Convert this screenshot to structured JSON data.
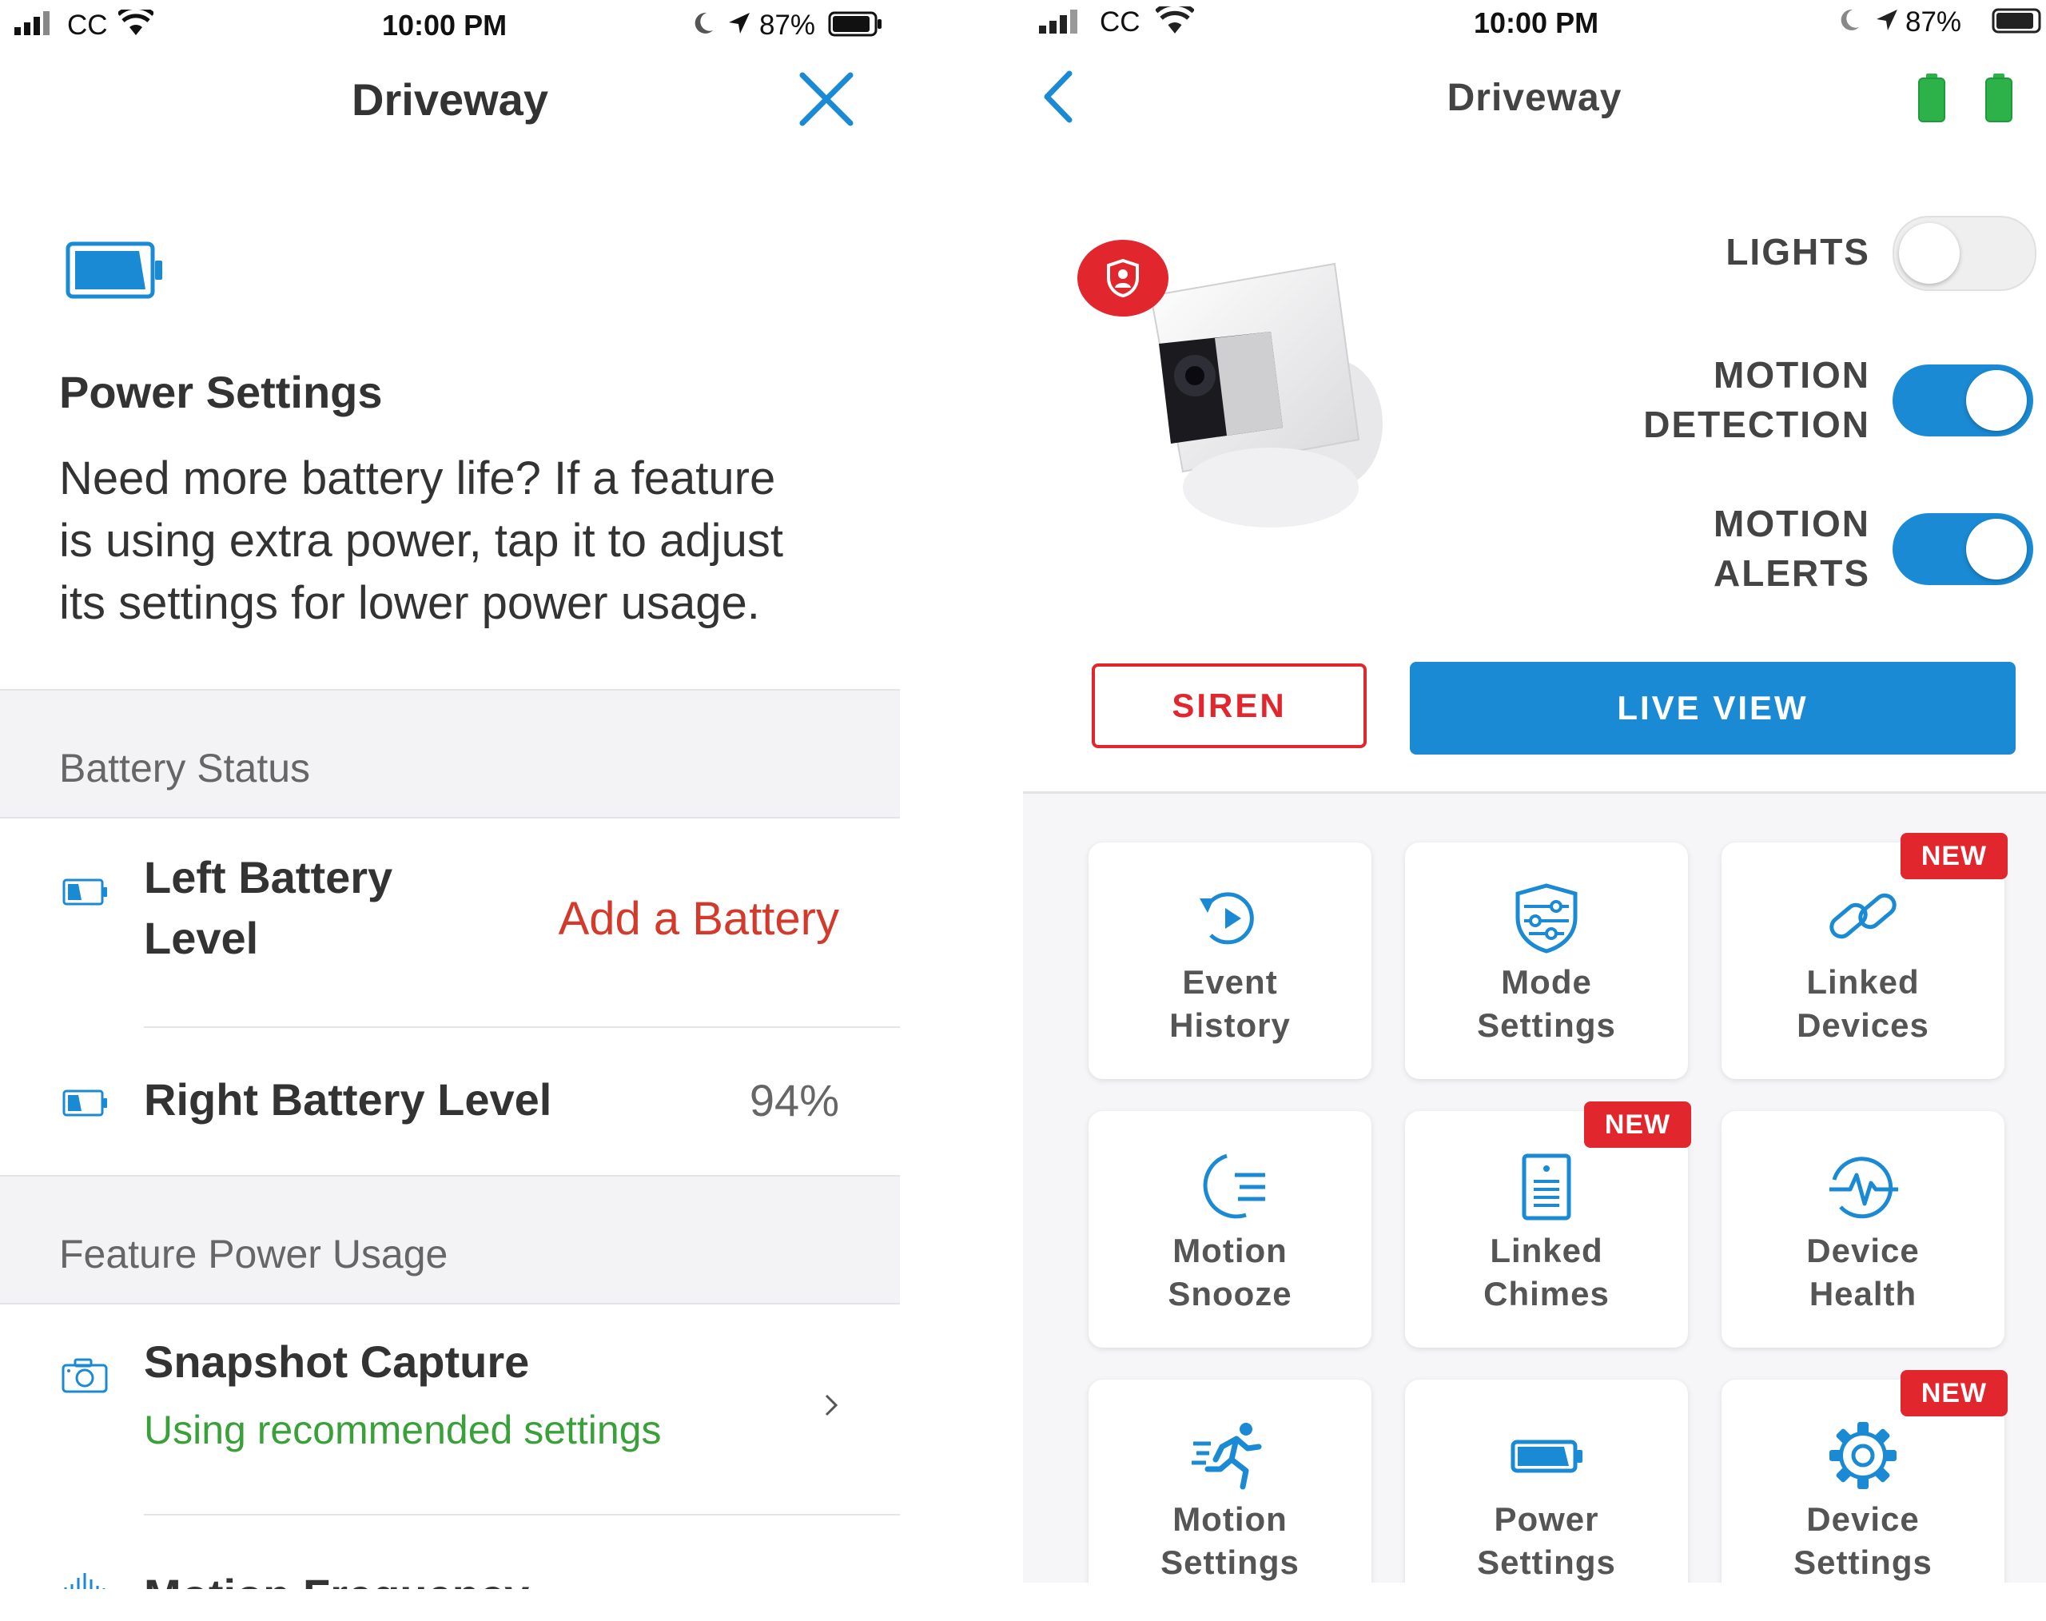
{
  "left": {
    "status_bar": {
      "carrier": "CC",
      "time": "10:00 PM",
      "battery_pct": "87%"
    },
    "nav": {
      "title": "Driveway"
    },
    "intro": {
      "heading": "Power Settings",
      "line1": "Need more battery life? If a feature",
      "line2": "is using extra power, tap it to adjust",
      "line3": "its settings for lower power usage."
    },
    "battery_status": {
      "section_title": "Battery Status",
      "left_line1": "Left Battery",
      "left_line2": "Level",
      "left_action": "Add a Battery",
      "right_label": "Right Battery Level",
      "right_value": "94%"
    },
    "feature_usage": {
      "section_title": "Feature Power Usage",
      "snapshot_title": "Snapshot Capture",
      "snapshot_sub": "Using recommended settings",
      "motion_freq_title": "Motion Frequency"
    }
  },
  "right": {
    "status_bar": {
      "carrier": "CC",
      "time": "10:00 PM",
      "battery_pct": "87%"
    },
    "nav": {
      "title": "Driveway"
    },
    "toggles": {
      "lights": {
        "label": "LIGHTS",
        "on": false
      },
      "motion_detection": {
        "line1": "MOTION",
        "line2": "DETECTION",
        "on": true
      },
      "motion_alerts": {
        "line1": "MOTION",
        "line2": "ALERTS",
        "on": true
      }
    },
    "buttons": {
      "siren": "SIREN",
      "live_view": "LIVE VIEW"
    },
    "colors": {
      "accent": "#1a8ad4",
      "danger": "#e1262d",
      "battery_green": "#2db24a",
      "success": "#3aa13a"
    },
    "tiles": [
      {
        "line1": "Event",
        "line2": "History",
        "icon": "event-history-icon",
        "badge": ""
      },
      {
        "line1": "Mode",
        "line2": "Settings",
        "icon": "mode-settings-icon",
        "badge": ""
      },
      {
        "line1": "Linked",
        "line2": "Devices",
        "icon": "link-icon",
        "badge": "NEW"
      },
      {
        "line1": "Motion",
        "line2": "Snooze",
        "icon": "snooze-moon-icon",
        "badge": ""
      },
      {
        "line1": "Linked",
        "line2": "Chimes",
        "icon": "chime-icon",
        "badge": "NEW"
      },
      {
        "line1": "Device",
        "line2": "Health",
        "icon": "heartbeat-icon",
        "badge": ""
      },
      {
        "line1": "Motion",
        "line2": "Settings",
        "icon": "running-person-icon",
        "badge": ""
      },
      {
        "line1": "Power",
        "line2": "Settings",
        "icon": "battery-icon",
        "badge": ""
      },
      {
        "line1": "Device",
        "line2": "Settings",
        "icon": "gear-icon",
        "badge": "NEW"
      }
    ]
  }
}
